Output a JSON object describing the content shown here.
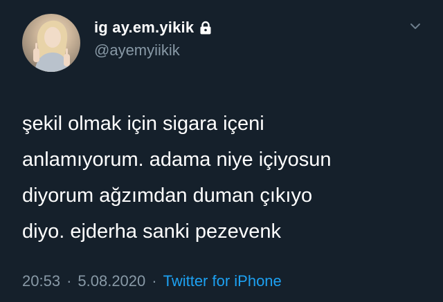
{
  "tweet": {
    "author": {
      "display_name": "ig ay.em.yikik",
      "handle": "@ayemyiikik",
      "protected_icon": "lock-icon"
    },
    "text_lines": [
      "şekil olmak için sigara içeni",
      "anlamıyorum. adama niye içiyosun",
      "diyorum ağzımdan duman çıkıyo",
      "diyo. ejderha sanki pezevenk"
    ],
    "time": "20:53",
    "date": "5.08.2020",
    "separator": "·",
    "source": "Twitter for iPhone",
    "menu_icon": "chevron-down-icon"
  },
  "colors": {
    "background": "#15202b",
    "text": "#ffffff",
    "secondary": "#8899a6",
    "link": "#1da1f2"
  }
}
